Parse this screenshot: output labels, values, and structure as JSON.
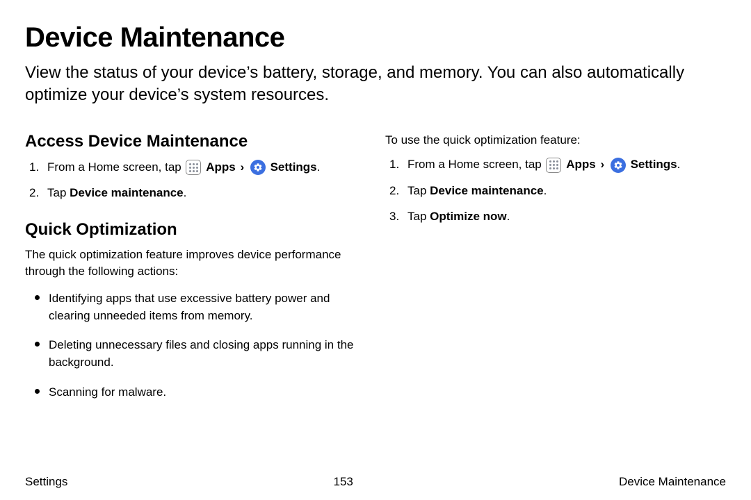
{
  "title": "Device Maintenance",
  "intro": "View the status of your device’s battery, storage, and memory. You can also automatically optimize your device’s system resources.",
  "left": {
    "h_access": "Access Device Maintenance",
    "step1_pre": "From a Home screen, tap ",
    "apps_label": "Apps",
    "settings_label": "Settings",
    "step2_pre": "Tap ",
    "step2_bold": "Device maintenance",
    "h_quick": "Quick Optimization",
    "quick_intro": "The quick optimization feature improves device performance through the following actions:",
    "bullets": [
      "Identifying apps that use excessive battery power and clearing unneeded items from memory.",
      "Deleting unnecessary files and closing apps running in the background.",
      "Scanning for malware."
    ]
  },
  "right": {
    "lead": "To use the quick optimization feature:",
    "step1_pre": "From a Home screen, tap ",
    "apps_label": "Apps",
    "settings_label": "Settings",
    "step2_pre": "Tap ",
    "step2_bold": "Device maintenance",
    "step3_pre": "Tap ",
    "step3_bold": "Optimize now"
  },
  "footer": {
    "left": "Settings",
    "center": "153",
    "right": "Device Maintenance"
  },
  "glyphs": {
    "chevron": "›",
    "period": "."
  }
}
